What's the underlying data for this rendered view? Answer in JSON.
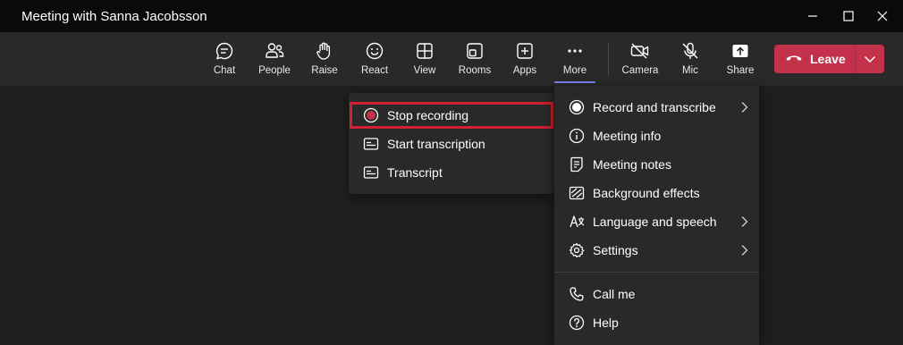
{
  "window": {
    "title": "Meeting with Sanna Jacobsson",
    "controls": [
      "minimize-icon",
      "maximize-icon",
      "close-icon"
    ]
  },
  "toolbar": {
    "buttons": [
      {
        "id": "chat",
        "label": "Chat",
        "icon": "chat-icon"
      },
      {
        "id": "people",
        "label": "People",
        "icon": "people-icon"
      },
      {
        "id": "raise",
        "label": "Raise",
        "icon": "raise-hand-icon"
      },
      {
        "id": "react",
        "label": "React",
        "icon": "smile-icon"
      },
      {
        "id": "view",
        "label": "View",
        "icon": "grid-icon"
      },
      {
        "id": "rooms",
        "label": "Rooms",
        "icon": "rooms-icon"
      },
      {
        "id": "apps",
        "label": "Apps",
        "icon": "plus-square-icon"
      },
      {
        "id": "more",
        "label": "More",
        "icon": "ellipsis-icon",
        "active": true
      },
      {
        "id": "camera",
        "label": "Camera",
        "icon": "camera-off-icon"
      },
      {
        "id": "mic",
        "label": "Mic",
        "icon": "mic-off-icon"
      },
      {
        "id": "share",
        "label": "Share",
        "icon": "share-icon"
      }
    ],
    "leave": {
      "label": "Leave",
      "icon": "phone-hangup-icon",
      "dropdown_icon": "chevron-down-icon"
    }
  },
  "recording_submenu": {
    "items": [
      {
        "label": "Stop recording",
        "icon": "record-stop-icon",
        "highlighted": true
      },
      {
        "label": "Start transcription",
        "icon": "transcription-icon"
      },
      {
        "label": "Transcript",
        "icon": "transcript-icon"
      }
    ]
  },
  "more_menu": {
    "items": [
      {
        "label": "Record and transcribe",
        "icon": "record-icon",
        "has_submenu": true
      },
      {
        "label": "Meeting info",
        "icon": "info-icon"
      },
      {
        "label": "Meeting notes",
        "icon": "notes-icon"
      },
      {
        "label": "Background effects",
        "icon": "background-effects-icon"
      },
      {
        "label": "Language and speech",
        "icon": "language-icon",
        "has_submenu": true
      },
      {
        "label": "Settings",
        "icon": "gear-icon",
        "has_submenu": true
      },
      {
        "label": "Call me",
        "icon": "phone-icon"
      },
      {
        "label": "Help",
        "icon": "help-icon"
      }
    ]
  },
  "colors": {
    "background": "#1f1f1f",
    "titlebar": "#0a0a0a",
    "toolbar": "#292929",
    "leave": "#c4314b",
    "active_indicator": "#7f85f5",
    "highlight_border": "#d1202f",
    "record_dot": "#c4314b"
  }
}
